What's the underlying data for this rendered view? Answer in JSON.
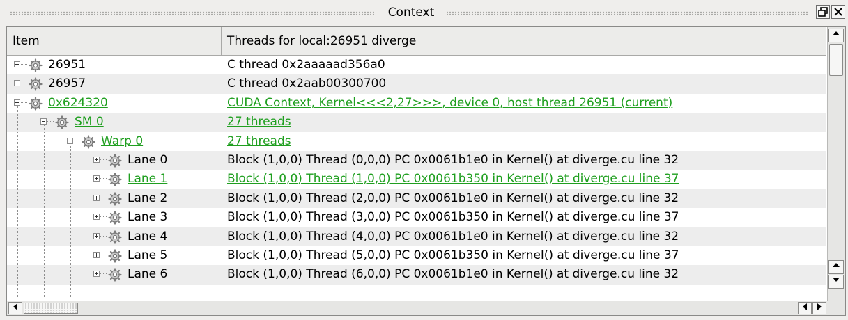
{
  "window": {
    "title": "Context",
    "restore_icon": "restore-icon",
    "close_icon": "close-icon"
  },
  "table": {
    "columns": [
      "Item",
      "Threads for local:26951 diverge"
    ],
    "rows": [
      {
        "item": "26951",
        "value": "C thread 0x2aaaaad356a0",
        "level": 0,
        "state": "collapsed",
        "highlight": false
      },
      {
        "item": "26957",
        "value": "C thread 0x2aab00300700",
        "level": 0,
        "state": "collapsed",
        "highlight": false
      },
      {
        "item": "0x624320",
        "value": "CUDA Context, Kernel<<<2,27>>>, device 0, host thread 26951 (current)",
        "level": 0,
        "state": "expanded",
        "highlight": true
      },
      {
        "item": "SM 0",
        "value": "27 threads",
        "level": 1,
        "state": "expanded",
        "highlight": true
      },
      {
        "item": "Warp 0",
        "value": "27 threads",
        "level": 2,
        "state": "expanded",
        "highlight": true
      },
      {
        "item": "Lane 0",
        "value": "Block (1,0,0) Thread (0,0,0) PC 0x0061b1e0 in Kernel() at diverge.cu line 32",
        "level": 3,
        "state": "collapsed",
        "highlight": false
      },
      {
        "item": "Lane 1",
        "value": "Block (1,0,0) Thread (1,0,0) PC 0x0061b350 in Kernel() at diverge.cu line 37",
        "level": 3,
        "state": "collapsed",
        "highlight": true
      },
      {
        "item": "Lane 2",
        "value": "Block (1,0,0) Thread (2,0,0) PC 0x0061b1e0 in Kernel() at diverge.cu line 32",
        "level": 3,
        "state": "collapsed",
        "highlight": false
      },
      {
        "item": "Lane 3",
        "value": "Block (1,0,0) Thread (3,0,0) PC 0x0061b350 in Kernel() at diverge.cu line 37",
        "level": 3,
        "state": "collapsed",
        "highlight": false
      },
      {
        "item": "Lane 4",
        "value": "Block (1,0,0) Thread (4,0,0) PC 0x0061b1e0 in Kernel() at diverge.cu line 32",
        "level": 3,
        "state": "collapsed",
        "highlight": false
      },
      {
        "item": "Lane 5",
        "value": "Block (1,0,0) Thread (5,0,0) PC 0x0061b350 in Kernel() at diverge.cu line 37",
        "level": 3,
        "state": "collapsed",
        "highlight": false
      },
      {
        "item": "Lane 6",
        "value": "Block (1,0,0) Thread (6,0,0) PC 0x0061b1e0 in Kernel() at diverge.cu line 32",
        "level": 3,
        "state": "collapsed",
        "highlight": false
      }
    ]
  },
  "icons": {
    "row_icon": "gear-icon",
    "scroll_up": "arrow-up-icon",
    "scroll_down": "arrow-down-icon",
    "scroll_left": "arrow-left-icon",
    "scroll_right": "arrow-right-icon"
  },
  "colors": {
    "highlight": "#1f9f1f",
    "alt_row": "#ededed"
  }
}
